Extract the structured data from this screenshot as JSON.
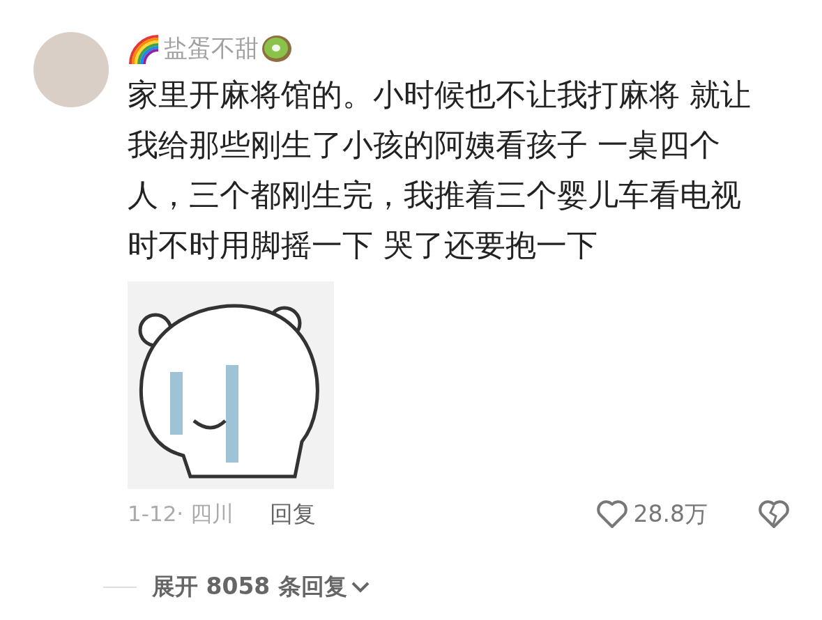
{
  "comment": {
    "author": "盐蛋不甜",
    "text": "家里开麻将馆的。小时候也不让我打麻将 就让我给那些刚生了小孩的阿姨看孩子 一桌四个人，三个都刚生完，我推着三个婴儿车看电视时不时用脚摇一下 哭了还要抱一下",
    "date_location": "1-12· 四川",
    "reply_label": "回复",
    "likes": "28.8万",
    "liked": false
  },
  "expand_replies": {
    "label": "展开 8058 条回复"
  }
}
